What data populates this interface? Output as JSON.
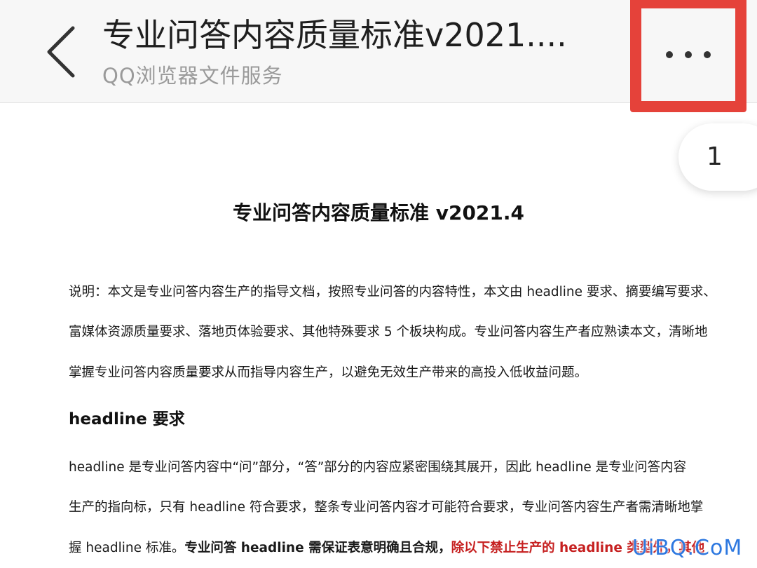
{
  "header": {
    "title": "专业问答内容质量标准v2021....",
    "subtitle": "QQ浏览器文件服务",
    "back_icon": "chevron-left-icon",
    "more_icon": "more-horizontal-icon",
    "highlight_color": "#e5423a"
  },
  "page_indicator": "1",
  "document": {
    "title": "专业问答内容质量标准 v2021.4",
    "intro_lines": [
      "说明：本文是专业问答内容生产的指导文档，按照专业问答的内容特性，本文由 headline 要求、摘要编写要求、",
      "富媒体资源质量要求、落地页体验要求、其他特殊要求 5 个板块构成。专业问答内容生产者应熟读本文，清晰地",
      "掌握专业问答内容质量要求从而指导内容生产，以避免无效生产带来的高投入低收益问题。"
    ],
    "section_heading": "headline 要求",
    "section_lines": [
      "headline 是专业问答内容中“问”部分，“答”部分的内容应紧密围绕其展开，因此 headline 是专业问答内容",
      "生产的指向标，只有 headline 符合要求，整条专业问答内容才可能符合要求，专业问答内容生产者需清晰地掌"
    ],
    "last_line": {
      "normal": "握 headline 标准。",
      "bold": "专业问答 headline 需保证表意明确且合规，",
      "red": "除以下禁止生产的 headline 类型外，其他"
    },
    "red_color": "#c62020"
  },
  "watermark": "UiBQ.CoM"
}
